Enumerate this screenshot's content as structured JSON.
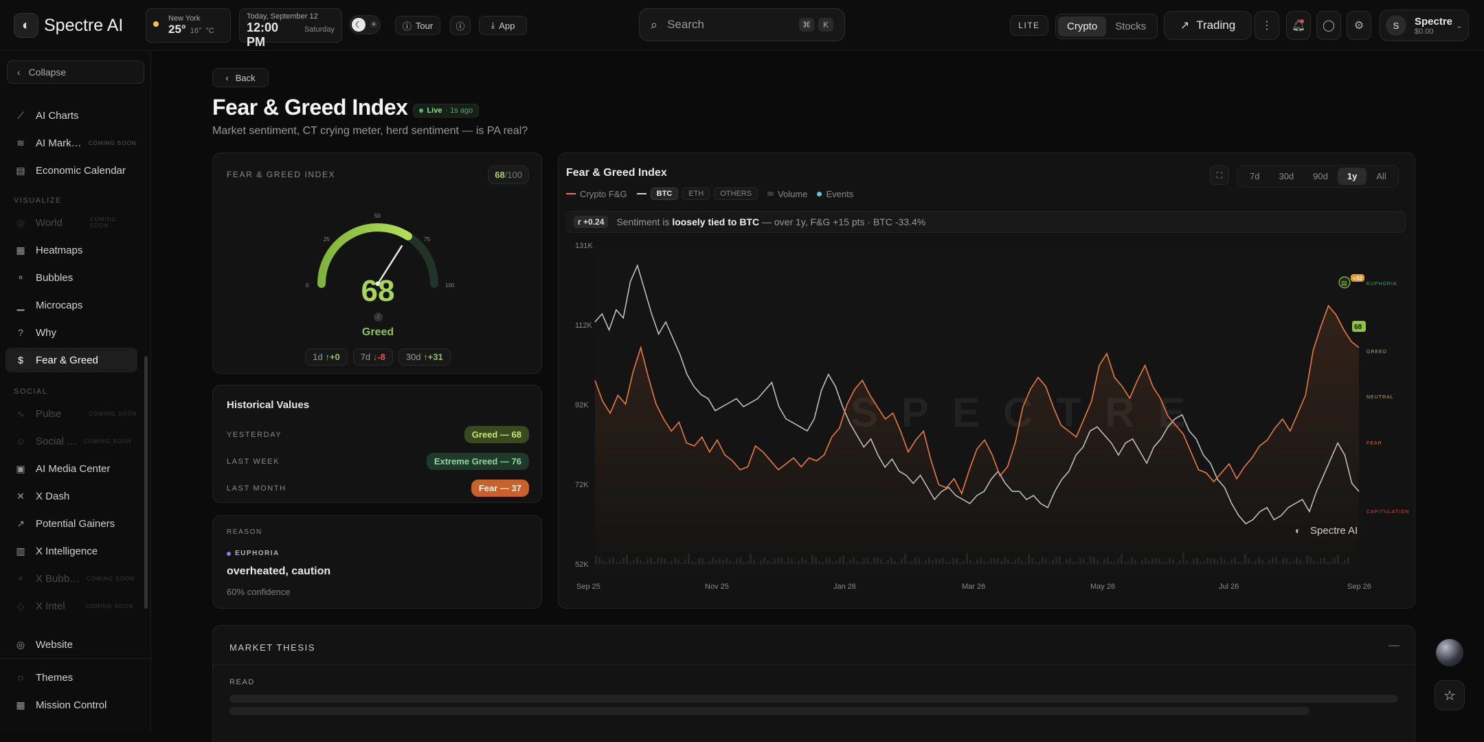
{
  "app": {
    "name": "Spectre AI"
  },
  "weather": {
    "city": "New York",
    "temp": "25°",
    "low": "16°",
    "unit": "°C"
  },
  "datetime": {
    "label": "Today, September 12",
    "time": "12:00 PM",
    "day": "Saturday"
  },
  "topbar": {
    "tour": "Tour",
    "app": "App",
    "lite": "LITE",
    "trading": "Trading"
  },
  "search": {
    "placeholder": "Search",
    "k1": "⌘",
    "k2": "K"
  },
  "market_toggle": {
    "crypto": "Crypto",
    "stocks": "Stocks"
  },
  "user": {
    "initial": "S",
    "name": "Spectre",
    "balance": "$0.00"
  },
  "sidebar": {
    "collapse": "Collapse",
    "items": [
      {
        "label": "AI Charts"
      },
      {
        "label": "AI Mark…",
        "soon": "COMING SOON"
      },
      {
        "label": "Economic Calendar"
      },
      {
        "label": "World",
        "soon": "COMING SOON"
      },
      {
        "label": "Heatmaps"
      },
      {
        "label": "Bubbles"
      },
      {
        "label": "Microcaps"
      },
      {
        "label": "Why"
      },
      {
        "label": "Fear & Greed"
      },
      {
        "label": "Pulse",
        "soon": "COMING SOON"
      },
      {
        "label": "Social …",
        "soon": "COMING SOON"
      },
      {
        "label": "AI Media Center"
      },
      {
        "label": "X Dash"
      },
      {
        "label": "Potential Gainers"
      },
      {
        "label": "X Intelligence"
      },
      {
        "label": "X Bubb…",
        "soon": "COMING SOON"
      },
      {
        "label": "X Intel",
        "soon": "COMING SOON"
      },
      {
        "label": "Website"
      },
      {
        "label": "Themes"
      },
      {
        "label": "Mission Control"
      }
    ],
    "sections": {
      "visualize": "VISUALIZE",
      "social": "SOCIAL"
    }
  },
  "page": {
    "back": "Back",
    "title": "Fear & Greed Index",
    "live": "Live",
    "updated": "· 1s ago",
    "subtitle": "Market sentiment, CT crying meter, herd sentiment — is PA real?"
  },
  "gauge": {
    "label": "FEAR & GREED INDEX",
    "score": "68",
    "score_max": "/100",
    "value": 68,
    "ticks": [
      "0",
      "25",
      "50",
      "75",
      "100"
    ],
    "state": "Greed",
    "changes": [
      {
        "period": "1d",
        "arrow": "↑",
        "value": "+0"
      },
      {
        "period": "7d",
        "arrow": "↓",
        "value": "-8"
      },
      {
        "period": "30d",
        "arrow": "↑",
        "value": "+31"
      }
    ]
  },
  "historical": {
    "title": "Historical Values",
    "rows": [
      {
        "label": "YESTERDAY",
        "badge": "Greed — 68",
        "color": "#8fb83a"
      },
      {
        "label": "LAST WEEK",
        "badge": "Extreme Greed — 76",
        "color": "#3f7f55"
      },
      {
        "label": "LAST MONTH",
        "badge": "Fear — 37",
        "color": "#e27a33"
      }
    ]
  },
  "reason": {
    "label": "REASON",
    "tag": "EUPHORIA",
    "text": "overheated, caution",
    "confidence": "60% confidence"
  },
  "chart_panel": {
    "title": "Fear & Greed Index",
    "ranges": [
      "7d",
      "30d",
      "90d",
      "1y",
      "All"
    ],
    "active_range": "1y",
    "legend": {
      "fg": "Crypto F&G",
      "btc": "BTC",
      "eth": "ETH",
      "others": "OTHERS",
      "volume": "Volume",
      "events": "Events"
    },
    "corr_value": "r +0.24",
    "corr_prefix": "Sentiment is",
    "corr_strong": "loosely tied to BTC",
    "corr_suffix": "— over 1y, F&G +15 pts · BTC -33.4%",
    "watermark": "SPECTRE",
    "brand": "Spectre AI",
    "end_label": "68",
    "event_label": "+33"
  },
  "chart_data": {
    "type": "line",
    "x_ticks": [
      "Sep 25",
      "Nov 25",
      "Jan 26",
      "Mar 26",
      "May 26",
      "Jul 26",
      "Sep 26"
    ],
    "y_ticks": [
      "131K",
      "112K",
      "92K",
      "72K",
      "52K"
    ],
    "zones": [
      "EUPHORIA",
      "GREED",
      "NEUTRAL",
      "FEAR",
      "CAPITULATION"
    ],
    "zone_colors": [
      "#4aa37a",
      "#8fc43a",
      "#d6a632",
      "#e0643a",
      "#d84545"
    ],
    "ylim": [
      52,
      131
    ],
    "series": [
      {
        "name": "BTC",
        "color": "#bdbdbd",
        "values": [
          112,
          114,
          110,
          115,
          113,
          122,
          126,
          120,
          114,
          109,
          112,
          108,
          104,
          99,
          96,
          94,
          93,
          90,
          91,
          92,
          93,
          91,
          92,
          93,
          95,
          97,
          91,
          88,
          87,
          86,
          85,
          88,
          95,
          99,
          96,
          91,
          87,
          84,
          81,
          83,
          79,
          76,
          78,
          75,
          74,
          72,
          74,
          71,
          68,
          70,
          71,
          69,
          68,
          67,
          69,
          70,
          73,
          75,
          72,
          70,
          70,
          68,
          69,
          67,
          66,
          70,
          73,
          75,
          79,
          81,
          85,
          86,
          84,
          82,
          79,
          82,
          83,
          80,
          77,
          81,
          83,
          86,
          88,
          89,
          85,
          83,
          79,
          77,
          73,
          71,
          67,
          64,
          62,
          63,
          65,
          66,
          63,
          64,
          66,
          67,
          68,
          65,
          70,
          74,
          78,
          82,
          79,
          72,
          70
        ]
      },
      {
        "name": "Crypto F&G",
        "color": "#ea7b3c",
        "values": [
          57,
          50,
          46,
          52,
          49,
          60,
          68,
          58,
          49,
          44,
          40,
          43,
          36,
          35,
          38,
          33,
          37,
          32,
          30,
          27,
          28,
          35,
          33,
          30,
          27,
          29,
          31,
          28,
          31,
          30,
          32,
          38,
          41,
          49,
          54,
          57,
          52,
          48,
          44,
          46,
          40,
          33,
          37,
          40,
          30,
          22,
          21,
          24,
          19,
          27,
          34,
          37,
          32,
          25,
          28,
          36,
          48,
          54,
          58,
          55,
          48,
          42,
          40,
          38,
          44,
          50,
          62,
          66,
          58,
          55,
          51,
          57,
          62,
          55,
          51,
          45,
          42,
          39,
          33,
          27,
          26,
          23,
          26,
          29,
          24,
          28,
          31,
          35,
          37,
          41,
          44,
          40,
          46,
          52,
          67,
          75,
          82,
          79,
          74,
          70,
          68
        ]
      }
    ]
  },
  "thesis": {
    "title": "MARKET THESIS",
    "read": "READ"
  }
}
